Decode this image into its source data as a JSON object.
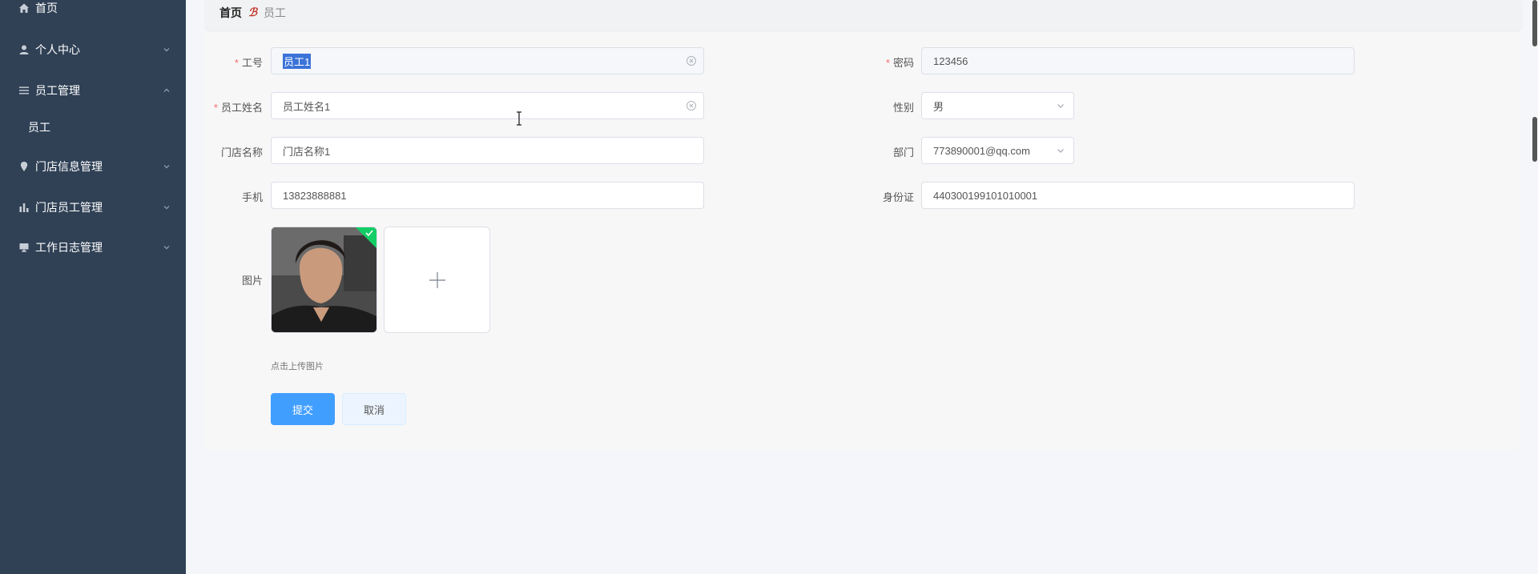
{
  "sidebar": {
    "items": [
      {
        "label": "首页",
        "icon": "home-icon"
      },
      {
        "label": "个人中心",
        "icon": "user-icon"
      },
      {
        "label": "员工管理",
        "icon": "menu-icon"
      },
      {
        "label": "员工",
        "icon": ""
      },
      {
        "label": "门店信息管理",
        "icon": "location-icon"
      },
      {
        "label": "门店员工管理",
        "icon": "bar-chart-icon"
      },
      {
        "label": "工作日志管理",
        "icon": "monitor-icon"
      }
    ]
  },
  "breadcrumb": {
    "home": "首页",
    "separator": "ℬ",
    "current": "员工"
  },
  "form": {
    "employee_id": {
      "label": "工号",
      "value": "员工1"
    },
    "password": {
      "label": "密码",
      "value": "123456"
    },
    "employee_name": {
      "label": "员工姓名",
      "value": "员工姓名1"
    },
    "gender": {
      "label": "性别",
      "value": "男"
    },
    "store_name": {
      "label": "门店名称",
      "value": "门店名称1"
    },
    "department": {
      "label": "部门",
      "value": "773890001@qq.com"
    },
    "phone": {
      "label": "手机",
      "value": "13823888881"
    },
    "id_card": {
      "label": "身份证",
      "value": "440300199101010001"
    },
    "image": {
      "label": "图片",
      "tip": "点击上传图片"
    },
    "submit_label": "提交",
    "cancel_label": "取消"
  },
  "colors": {
    "sidebar_bg": "#304156",
    "primary": "#409eff",
    "required": "#f56c6c",
    "upload_success": "#13ce66"
  }
}
